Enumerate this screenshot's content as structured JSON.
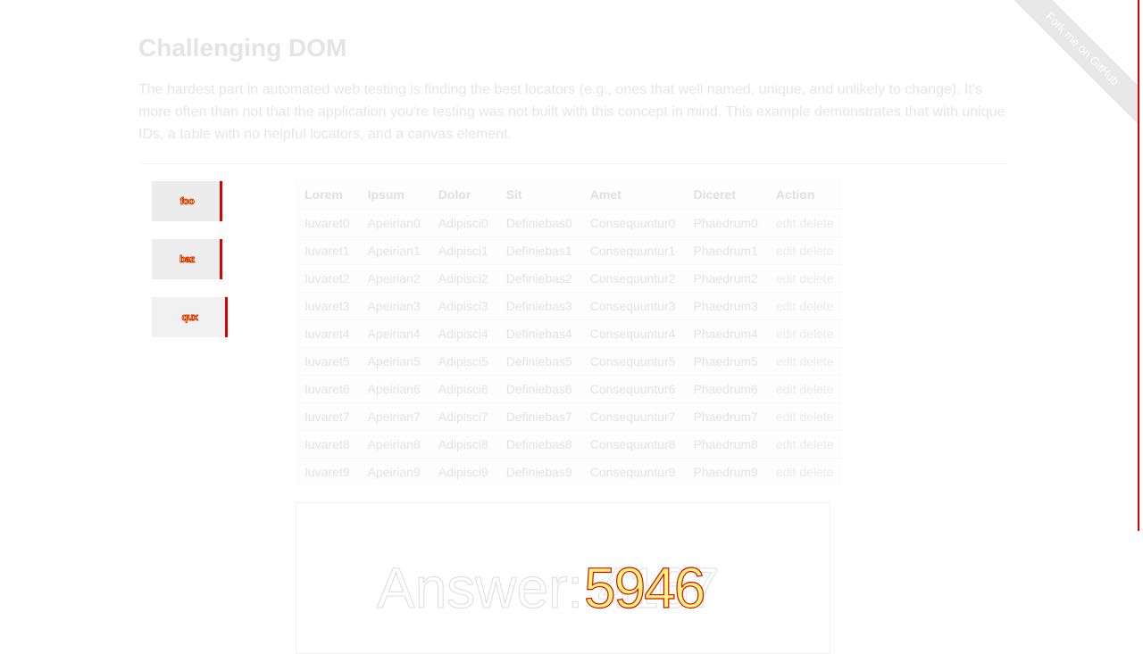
{
  "page": {
    "title": "Challenging DOM",
    "intro": "The hardest part in automated web testing is finding the best locators (e.g., ones that well named, unique, and unlikely to change). It's more often than not that the application you're testing was not built with this concept in mind. This example demonstrates that with unique IDs, a table with no helpful locators, and a canvas element."
  },
  "buttons": [
    {
      "label": "foo"
    },
    {
      "label": "baz"
    },
    {
      "label": "qux"
    }
  ],
  "table": {
    "headers": [
      "Lorem",
      "Ipsum",
      "Dolor",
      "Sit",
      "Amet",
      "Diceret",
      "Action"
    ],
    "rows": [
      [
        "Iuvaret0",
        "Apeirian0",
        "Adipisci0",
        "Definiebas0",
        "Consequuntur0",
        "Phaedrum0"
      ],
      [
        "Iuvaret1",
        "Apeirian1",
        "Adipisci1",
        "Definiebas1",
        "Consequuntur1",
        "Phaedrum1"
      ],
      [
        "Iuvaret2",
        "Apeirian2",
        "Adipisci2",
        "Definiebas2",
        "Consequuntur2",
        "Phaedrum2"
      ],
      [
        "Iuvaret3",
        "Apeirian3",
        "Adipisci3",
        "Definiebas3",
        "Consequuntur3",
        "Phaedrum3"
      ],
      [
        "Iuvaret4",
        "Apeirian4",
        "Adipisci4",
        "Definiebas4",
        "Consequuntur4",
        "Phaedrum4"
      ],
      [
        "Iuvaret5",
        "Apeirian5",
        "Adipisci5",
        "Definiebas5",
        "Consequuntur5",
        "Phaedrum5"
      ],
      [
        "Iuvaret6",
        "Apeirian6",
        "Adipisci6",
        "Definiebas6",
        "Consequuntur6",
        "Phaedrum6"
      ],
      [
        "Iuvaret7",
        "Apeirian7",
        "Adipisci7",
        "Definiebas7",
        "Consequuntur7",
        "Phaedrum7"
      ],
      [
        "Iuvaret8",
        "Apeirian8",
        "Adipisci8",
        "Definiebas8",
        "Consequuntur8",
        "Phaedrum8"
      ],
      [
        "Iuvaret9",
        "Apeirian9",
        "Adipisci9",
        "Definiebas9",
        "Consequuntur9",
        "Phaedrum9"
      ]
    ],
    "action_edit": "edit",
    "action_delete": "delete"
  },
  "canvas": {
    "answer_label": "Answer:",
    "answer_value": "5946",
    "answer_ghost": "4167"
  },
  "ribbon": {
    "label": "Fork me on GitHub"
  },
  "colors": {
    "accent_red": "#e00000",
    "highlight_yellow": "#ffe000"
  }
}
